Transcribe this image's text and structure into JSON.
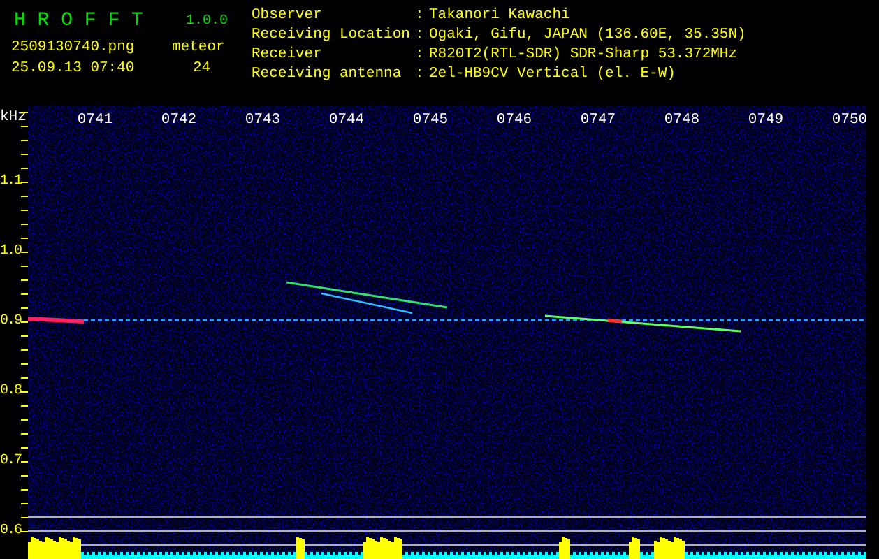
{
  "header": {
    "app_title": "H R O F F T",
    "version": "1.0.0",
    "filename": "2509130740.png",
    "datetime": "25.09.13 07:40",
    "meteor_label": "meteor",
    "meteor_count": "24"
  },
  "info": [
    {
      "label": "Observer",
      "separator": ":",
      "value": "Takanori Kawachi"
    },
    {
      "label": "Receiving Location",
      "separator": ":",
      "value": "Ogaki, Gifu, JAPAN (136.60E, 35.35N)"
    },
    {
      "label": "Receiver",
      "separator": ":",
      "value": "R820T2(RTL-SDR) SDR-Sharp 53.372MHz"
    },
    {
      "label": "Receiving antenna",
      "separator": ":",
      "value": "2el-HB9CV Vertical (el. E-W)"
    }
  ],
  "spectrogram": {
    "unit": "kHz",
    "time_labels": [
      "0741",
      "0742",
      "0743",
      "0744",
      "0745",
      "0746",
      "0747",
      "0748",
      "0749",
      "0750"
    ],
    "freq_labels": [
      "1.1",
      "1.0",
      "0.9",
      "0.8",
      "0.7",
      "0.6"
    ]
  }
}
